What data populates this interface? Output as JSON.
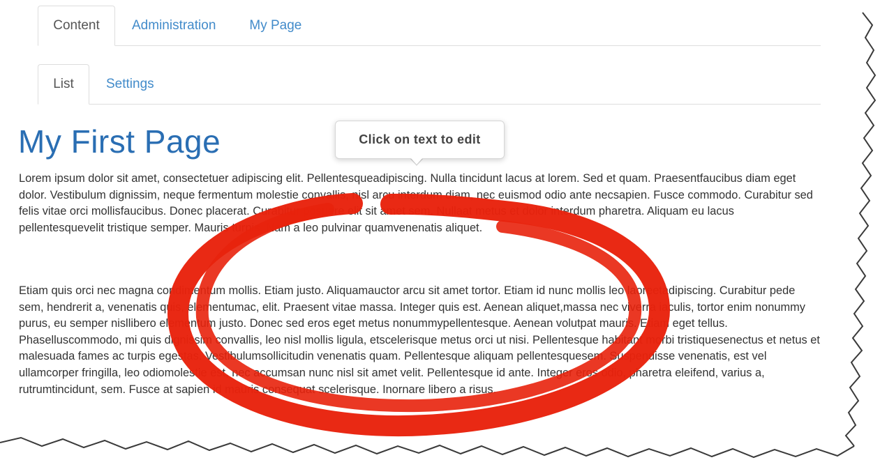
{
  "tabs_primary": [
    {
      "label": "Content",
      "active": true
    },
    {
      "label": "Administration",
      "active": false
    },
    {
      "label": "My Page",
      "active": false
    }
  ],
  "tabs_secondary": [
    {
      "label": "List",
      "active": true
    },
    {
      "label": "Settings",
      "active": false
    }
  ],
  "page": {
    "title": "My First Page",
    "paragraphs": [
      "Lorem ipsum dolor sit amet, consectetuer adipiscing elit. Pellentesqueadipiscing. Nulla tincidunt lacus at lorem. Sed et quam. Praesentfaucibus diam eget dolor. Vestibulum dignissim, neque fermentum molestie convallis, nisl arcu interdum diam, nec euismod odio ante necsapien. Fusce commodo. Curabitur sed felis vitae orci mollisfaucibus. Donec placerat. Curabitur posuere elit sit amet sem. Nullaat metus et dolor interdum pharetra. Aliquam eu lacus pellentesquevelit tristique semper. Mauris turpis. Nam a leo pulvinar quamvenenatis aliquet.",
      "Etiam quis orci nec magna condimentum mollis. Etiam justo. Aliquamauctor arcu sit amet tortor. Etiam id nunc mollis leo laoreetadipiscing. Curabitur pede sem, hendrerit a, venenatis quis, elementumac, elit. Praesent vitae massa. Integer quis est. Aenean aliquet,massa nec viverra iaculis, tortor enim nonummy purus, eu semper nisllibero elementum justo. Donec sed eros eget metus nonummypellentesque. Aenean volutpat mauris. Etiam eget tellus. Phaselluscommodo, mi quis dignissim convallis, leo nisl mollis ligula, etscelerisque metus orci ut nisi. Pellentesque habitant morbi tristiquesenectus et netus et malesuada fames ac turpis egestas. Vestibulumsollicitudin venenatis quam. Pellentesque aliquam pellentesquesem. Suspendisse venenatis, est vel ullamcorper fringilla, leo odiomolestie est, nec accumsan nunc nisl sit amet velit. Pellentesque id ante. Integer eros odio, pharetra eleifend, varius a, rutrumtincidunt, sem. Fusce at sapien id mauris consequat scelerisque. Inornare libero a risus."
    ]
  },
  "tooltip": {
    "text": "Click on text to edit"
  },
  "colors": {
    "link": "#428bca",
    "title": "#2a6eb3",
    "annotation": "#e8220c",
    "border": "#dddddd"
  }
}
